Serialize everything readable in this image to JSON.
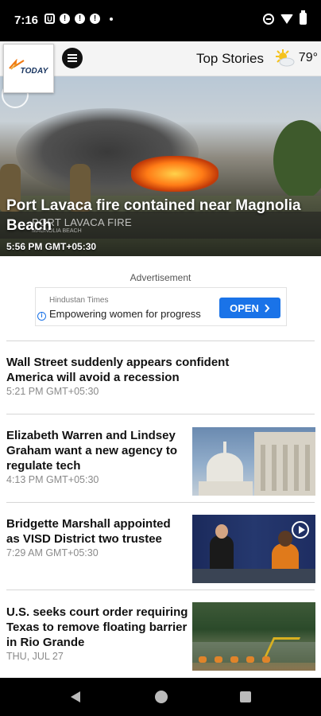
{
  "status_bar": {
    "time": "7:16",
    "notif_letter": "U"
  },
  "header": {
    "logo_text": "TODAY",
    "section_title": "Top Stories",
    "weather_temp": "79°",
    "icons": {
      "menu": "hamburger-menu-icon",
      "weather": "partly-sunny-icon"
    }
  },
  "hero": {
    "headline": "Port Lavaca fire contained near Magnolia Beach",
    "timestamp": "5:56 PM GMT+05:30",
    "chyron": "PORT LAVACA FIRE",
    "chyron_sub": "MAGNOLIA BEACH"
  },
  "ad": {
    "label": "Advertisement",
    "source": "Hindustan Times",
    "text": "Empowering women for progress",
    "cta": "OPEN",
    "cta_color": "#1a73e8"
  },
  "stories": [
    {
      "headline_lines": [
        "Wall Street suddenly appears confident",
        "America will avoid a recession"
      ],
      "time": "5:21 PM GMT+05:30"
    },
    {
      "headline_lines": [
        "Elizabeth Warren and Lindsey",
        "Graham want a new agency to",
        "regulate tech"
      ],
      "time": "4:13 PM GMT+05:30"
    },
    {
      "headline_lines": [
        "Bridgette Marshall appointed",
        "as VISD District two trustee"
      ],
      "time": "7:29 AM GMT+05:30"
    },
    {
      "headline_lines": [
        "U.S. seeks court order requiring",
        "Texas to remove floating barrier",
        "in Rio Grande"
      ],
      "time": "THU, JUL 27"
    }
  ]
}
